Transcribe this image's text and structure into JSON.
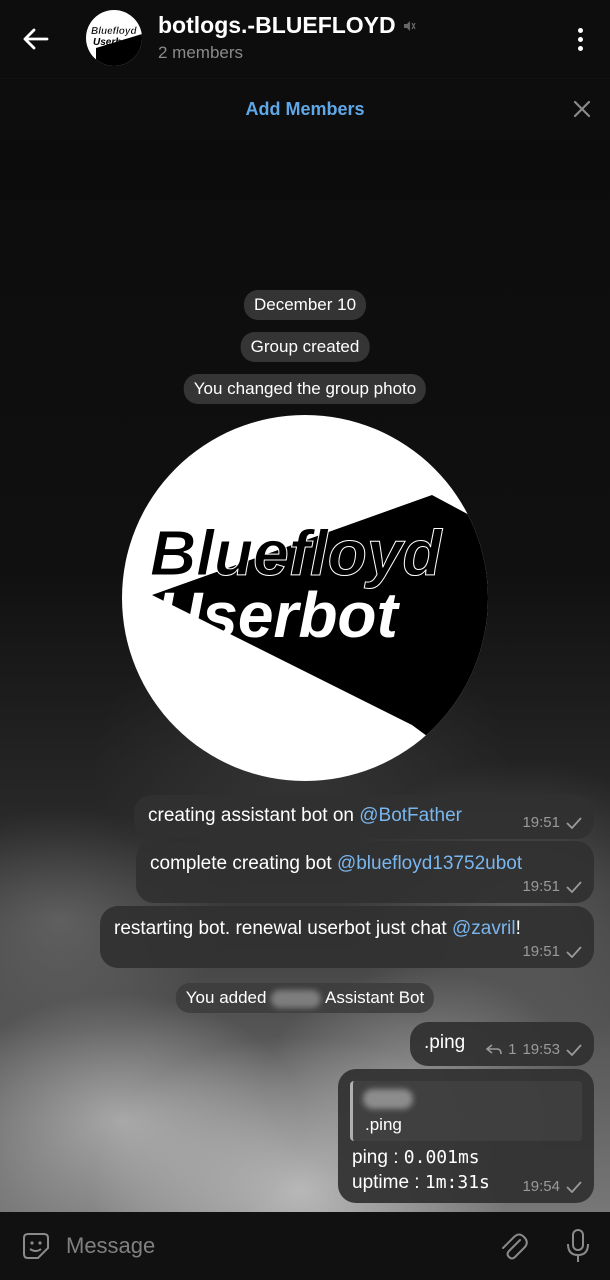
{
  "header": {
    "title": "botlogs.-BLUEFLOYD",
    "subtitle": "2 members",
    "avatar_text_1": "Bluefloyd",
    "avatar_text_2": "Userbot"
  },
  "banner": {
    "add_members": "Add Members"
  },
  "chat": {
    "date_pill": "December 10",
    "group_created": "Group created",
    "photo_changed": "You changed the group photo",
    "photo_text_1": "Bluefloyd",
    "photo_text_2": "Userbot",
    "messages": [
      {
        "text": "creating assistant bot on ",
        "mention": "@BotFather",
        "suffix": "",
        "time": "19:51"
      },
      {
        "text": "complete creating bot ",
        "mention": "@bluefloyd13752ubot",
        "suffix": "",
        "time": "19:51"
      },
      {
        "text": "restarting bot. renewal userbot just chat ",
        "mention": "@zavril",
        "suffix": "!",
        "time": "19:51"
      }
    ],
    "added_prefix": "You added",
    "added_suffix": "Assistant Bot",
    "ping_msg": {
      "text": ".ping",
      "reply_count": "1",
      "time": "19:53"
    },
    "reply_msg": {
      "quote_text": ".ping",
      "line1_label": "ping : ",
      "line1_value": "0.001ms",
      "line2_label": "uptime : ",
      "line2_value": "1m:31s",
      "time": "19:54"
    }
  },
  "input": {
    "placeholder": "Message"
  },
  "colors": {
    "accent": "#5fa8e8",
    "mention": "#7ab6ee",
    "bubble": "#303030"
  }
}
